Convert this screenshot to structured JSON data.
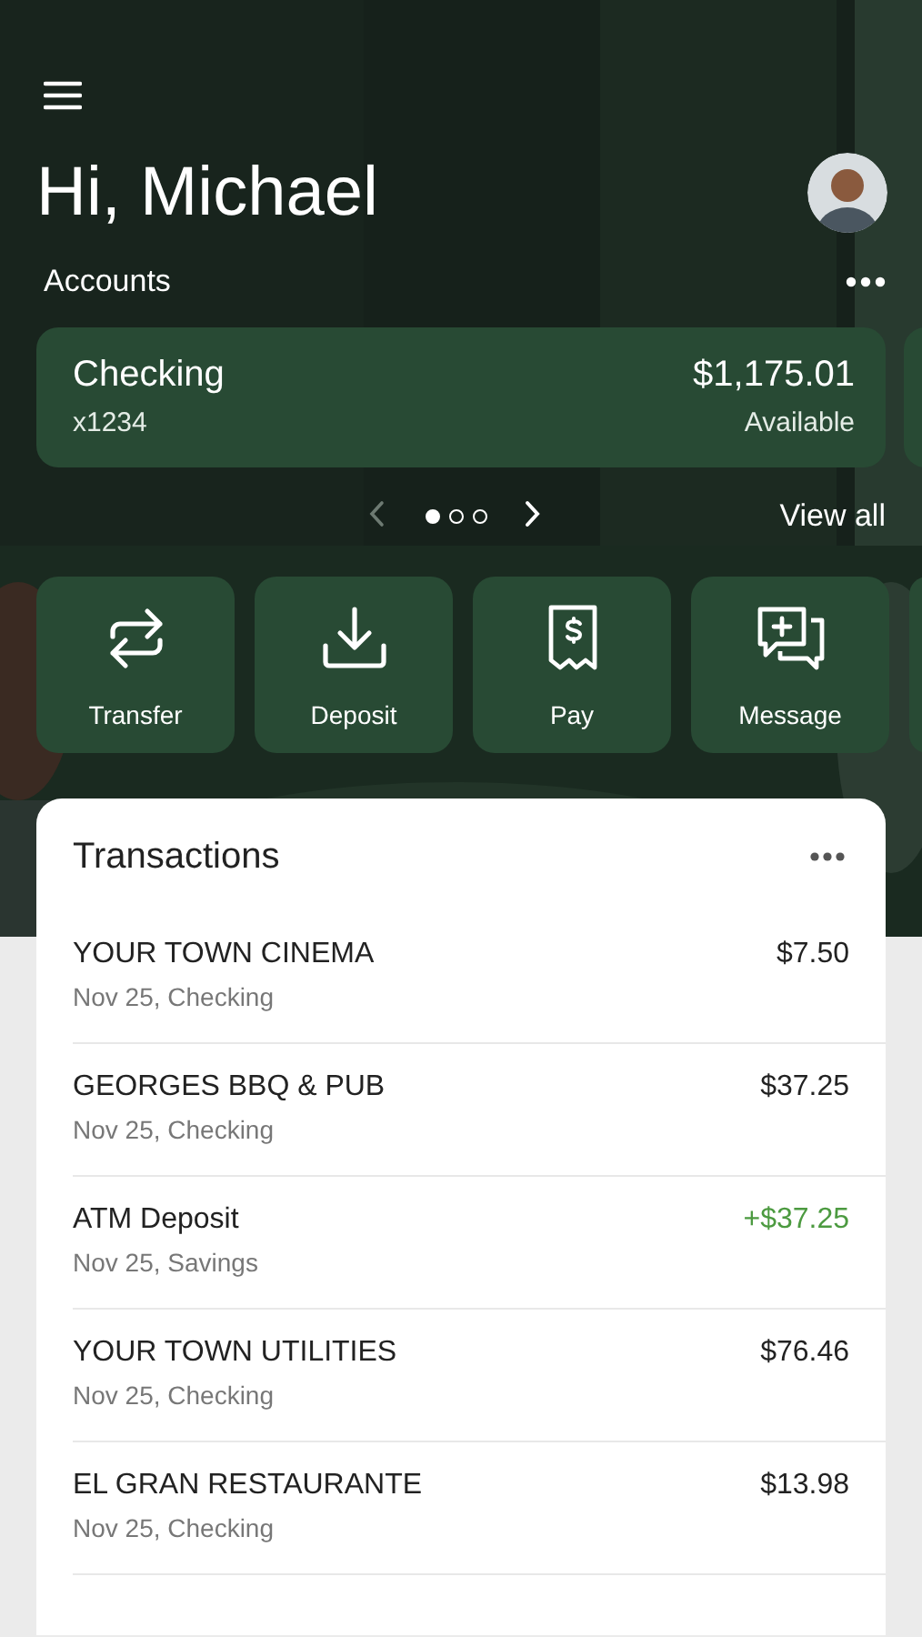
{
  "header": {
    "greeting": "Hi, Michael"
  },
  "accounts": {
    "label": "Accounts",
    "view_all": "View all",
    "cards": [
      {
        "name": "Checking",
        "number": "x1234",
        "balance": "$1,175.01",
        "balance_label": "Available"
      }
    ],
    "pages": [
      {
        "selected": true
      },
      {
        "selected": false
      },
      {
        "selected": false
      }
    ]
  },
  "actions": [
    {
      "kind": "transfer",
      "label": "Transfer"
    },
    {
      "kind": "deposit",
      "label": "Deposit"
    },
    {
      "kind": "pay",
      "label": "Pay"
    },
    {
      "kind": "message",
      "label": "Message"
    }
  ],
  "transactions": {
    "title": "Transactions",
    "rows": [
      {
        "name": "YOUR TOWN CINEMA",
        "detail": "Nov 25, Checking",
        "amount": "$7.50",
        "kind": "debit"
      },
      {
        "name": "GEORGES BBQ & PUB",
        "detail": "Nov 25, Checking",
        "amount": "$37.25",
        "kind": "debit"
      },
      {
        "name": "ATM Deposit",
        "detail": "Nov 25, Savings",
        "amount": "+$37.25",
        "kind": "credit"
      },
      {
        "name": "YOUR TOWN UTILITIES",
        "detail": "Nov 25, Checking",
        "amount": "$76.46",
        "kind": "debit"
      },
      {
        "name": "EL GRAN RESTAURANTE",
        "detail": "Nov 25, Checking",
        "amount": "$13.98",
        "kind": "debit"
      }
    ]
  }
}
